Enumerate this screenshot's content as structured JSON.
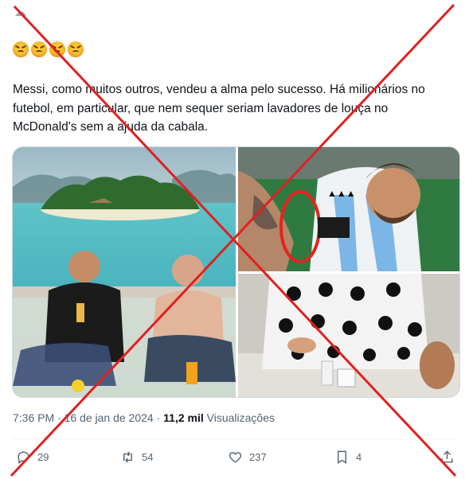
{
  "post": {
    "top_icon": "cloud-icon",
    "emojis": [
      "angry-face",
      "angry-face",
      "angry-face",
      "angry-face"
    ],
    "text": "Messi, como muitos outros, vendeu a alma pelo sucesso. Há milionários no futebol, em particular, que nem sequer seriam lavadores de louça no McDonald's sem a ajuda da cabala.",
    "media": [
      {
        "icon": "photo-beach-yacht"
      },
      {
        "icon": "photo-messi-tattoo-circled"
      },
      {
        "icon": "photo-panda-jacket-table"
      }
    ],
    "time": "7:36 PM",
    "date": "16 de jan de 2024",
    "views_count": "11,2 mil",
    "views_label": "Visualizações",
    "separator": "·"
  },
  "actions": {
    "replies": "29",
    "reposts": "54",
    "likes": "237",
    "bookmarks": "4"
  },
  "colors": {
    "text": "#0f1419",
    "secondary": "#536471",
    "border": "#cfd9de",
    "fact_check_x": "#e02020"
  }
}
